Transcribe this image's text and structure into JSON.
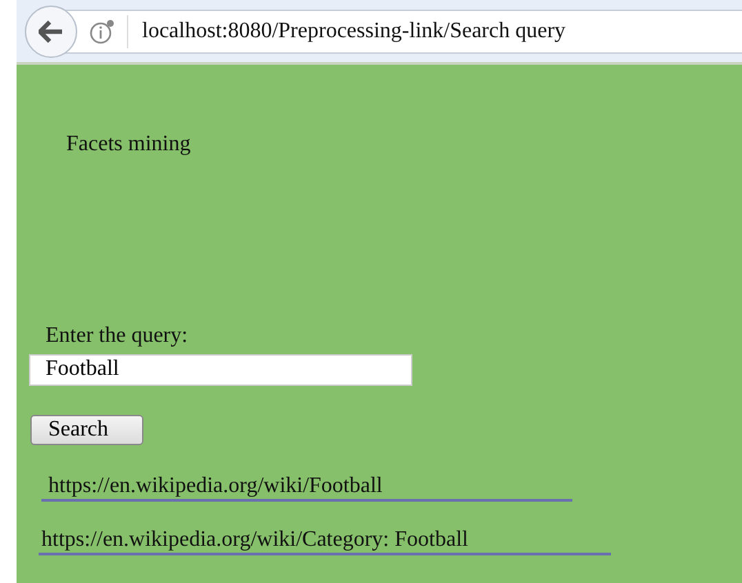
{
  "browser": {
    "url": "localhost:8080/Preprocessing-link/Search query"
  },
  "page": {
    "title": "Facets mining",
    "query_label": "Enter the query:",
    "query_field": {
      "value": "Football"
    },
    "search_button": "Search",
    "results": [
      {
        "text": "https://en.wikipedia.org/wiki/Football"
      },
      {
        "text": "https://en.wikipedia.org/wiki/Category: Football"
      }
    ]
  }
}
